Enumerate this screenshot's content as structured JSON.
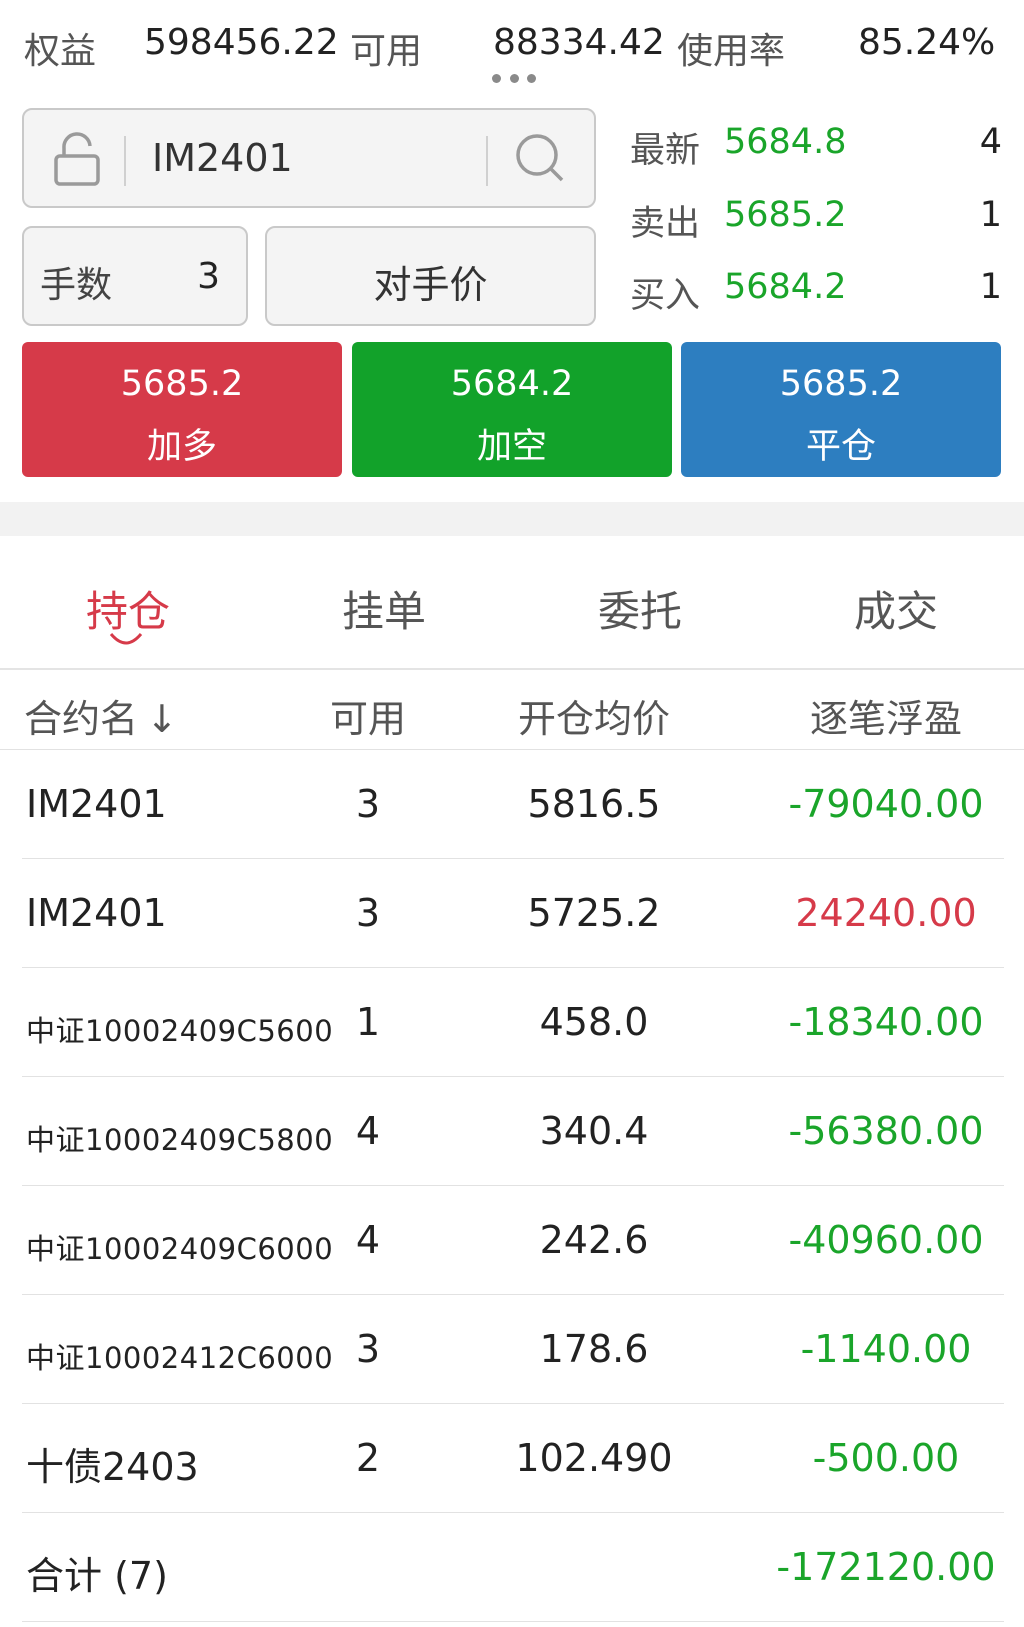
{
  "summary": {
    "equity_label": "权益",
    "equity_value": "598456.22",
    "available_label": "可用",
    "available_value": "88334.42",
    "usage_label": "使用率",
    "usage_value": "85.24%"
  },
  "order": {
    "symbol": "IM2401",
    "qty_label": "手数",
    "qty_value": "3",
    "price_type": "对手价"
  },
  "quotes": [
    {
      "label": "最新",
      "price": "5684.8",
      "volume": "4"
    },
    {
      "label": "卖出",
      "price": "5685.2",
      "volume": "1"
    },
    {
      "label": "买入",
      "price": "5684.2",
      "volume": "1"
    }
  ],
  "actions": [
    {
      "price": "5685.2",
      "label": "加多",
      "color": "#d63a49"
    },
    {
      "price": "5684.2",
      "label": "加空",
      "color": "#12a22a"
    },
    {
      "price": "5685.2",
      "label": "平仓",
      "color": "#2d7ec0"
    }
  ],
  "tabs": [
    "持仓",
    "挂单",
    "委托",
    "成交"
  ],
  "active_tab": "持仓",
  "table": {
    "headers": [
      "合约名",
      "可用",
      "开仓均价",
      "逐笔浮盈"
    ],
    "sort_indicator": "↓",
    "rows": [
      {
        "name": "IM2401",
        "avail": "3",
        "open_price": "5816.5",
        "pnl": "-79040.00"
      },
      {
        "name": "IM2401",
        "avail": "3",
        "open_price": "5725.2",
        "pnl": "24240.00"
      },
      {
        "name": "中证10002409C5600",
        "avail": "1",
        "open_price": "458.0",
        "pnl": "-18340.00"
      },
      {
        "name": "中证10002409C5800",
        "avail": "4",
        "open_price": "340.4",
        "pnl": "-56380.00"
      },
      {
        "name": "中证10002409C6000",
        "avail": "4",
        "open_price": "242.6",
        "pnl": "-40960.00"
      },
      {
        "name": "中证10002412C6000",
        "avail": "3",
        "open_price": "178.6",
        "pnl": "-1140.00"
      },
      {
        "name": "十债2403",
        "avail": "2",
        "open_price": "102.490",
        "pnl": "-500.00"
      }
    ],
    "total_label": "合计 (7)",
    "total_pnl": "-172120.00"
  },
  "colors": {
    "up": "#d63a49",
    "down": "#1aa52a",
    "accent": "#d63a49"
  }
}
